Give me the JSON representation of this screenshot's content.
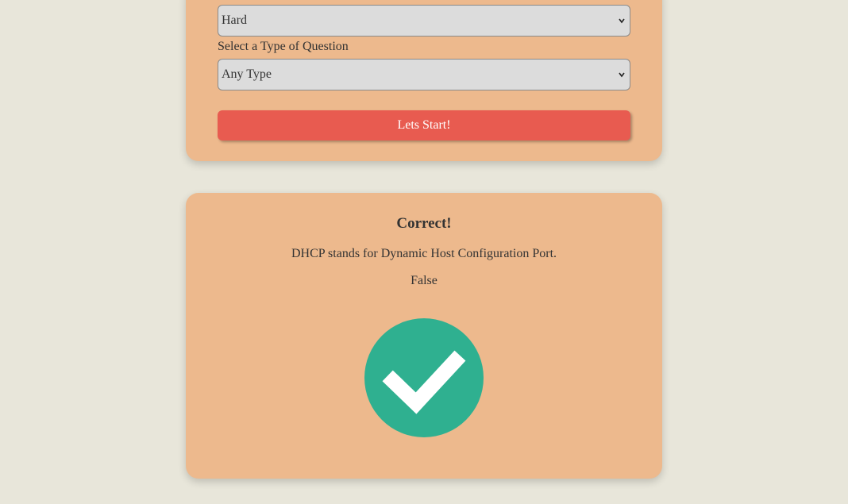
{
  "settings": {
    "difficulty_selected": "Hard",
    "type_label": "Select a Type of Question",
    "type_selected": "Any Type",
    "start_label": "Lets Start!"
  },
  "result": {
    "title": "Correct!",
    "question": "DHCP stands for Dynamic Host Configuration Port.",
    "answer": "False",
    "icon": "check-circle-icon"
  },
  "colors": {
    "background": "#e8e6da",
    "card": "#edb98d",
    "start_button": "#e85b50",
    "check_circle": "#2fb090"
  }
}
